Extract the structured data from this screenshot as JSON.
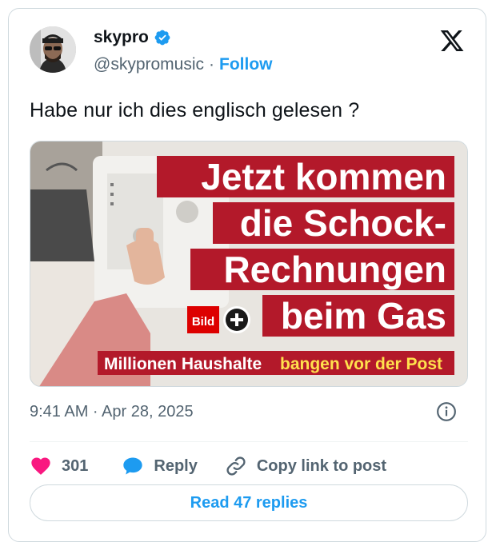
{
  "author": {
    "display_name": "skypro",
    "handle": "@skypromusic",
    "separator": "·",
    "follow_label": "Follow"
  },
  "tweet": {
    "text": "Habe nur ich dies englisch gelesen ?",
    "timestamp": "9:41 AM · Apr 28, 2025"
  },
  "media": {
    "headline_lines": [
      "Jetzt kommen",
      "die Schock-",
      "Rechnungen",
      "beim Gas"
    ],
    "brand": "Bild",
    "subline_white": "Millionen Haushalte",
    "subline_highlight": "bangen vor der Post"
  },
  "actions": {
    "like_count": "301",
    "reply_label": "Reply",
    "copy_label": "Copy link to post"
  },
  "read_replies_label": "Read 47 replies",
  "colors": {
    "accent": "#1d9bf0",
    "like": "#f91880",
    "text_secondary": "#536471",
    "headline_bg": "#b3192a"
  }
}
